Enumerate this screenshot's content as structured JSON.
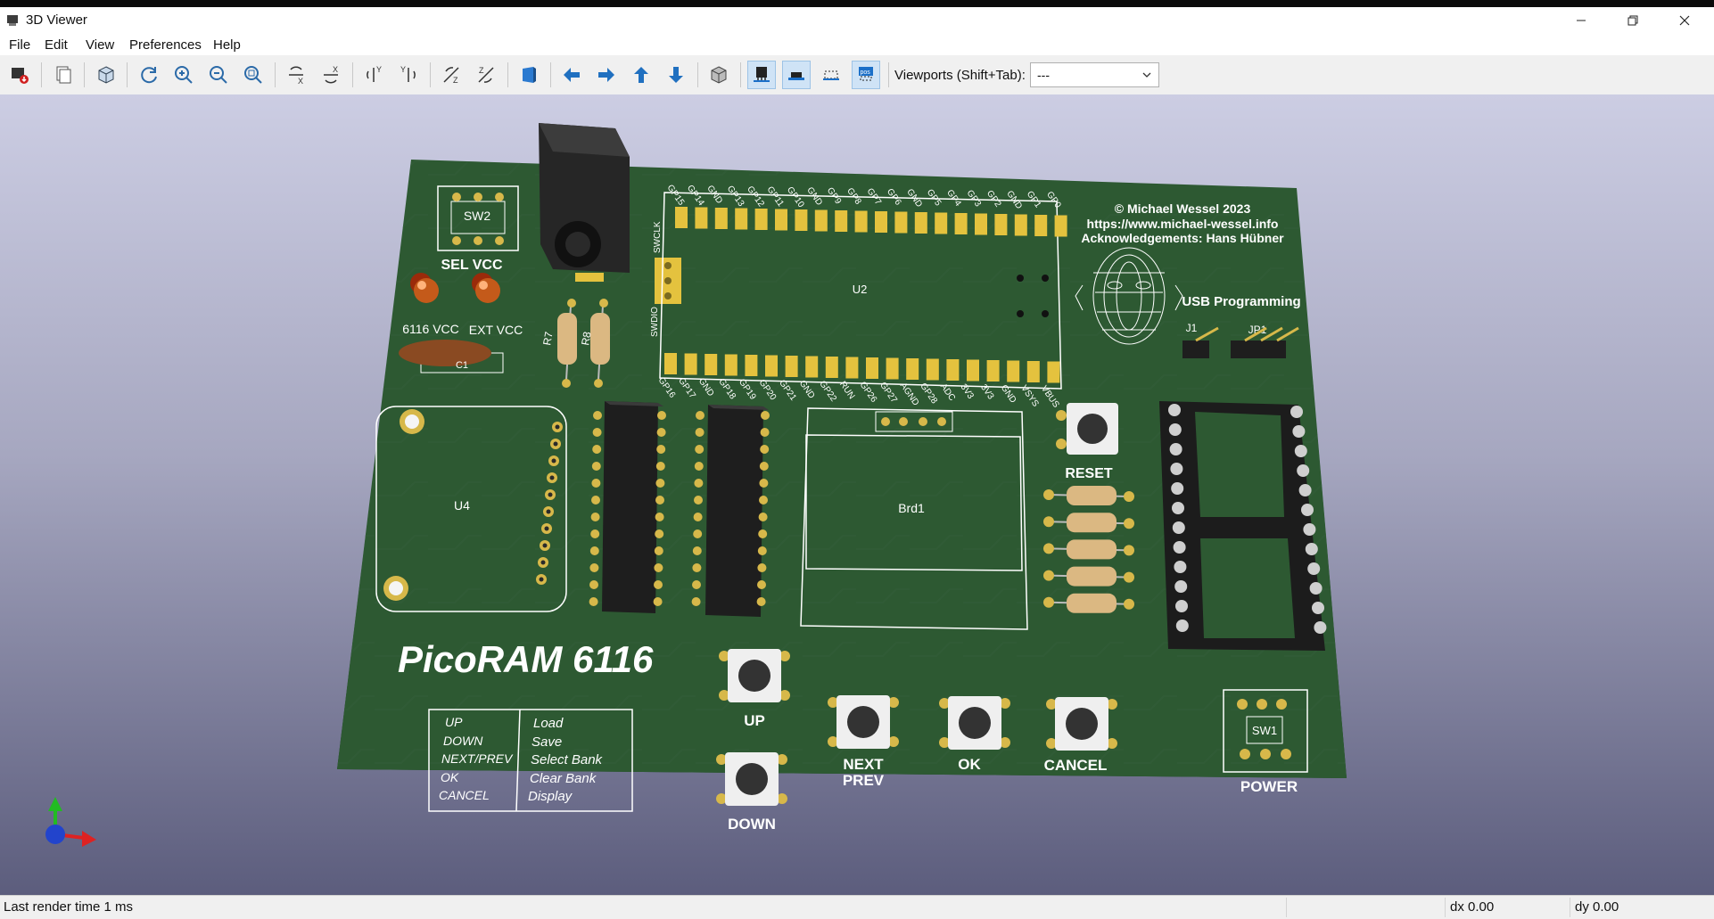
{
  "window": {
    "title": "3D Viewer"
  },
  "menu": [
    "File",
    "Edit",
    "View",
    "Preferences",
    "Help"
  ],
  "toolbar": {
    "viewports_label": "Viewports (Shift+Tab):",
    "viewports_value": "---"
  },
  "board": {
    "title": "PicoRAM 6116",
    "credits": [
      "© Michael Wessel 2023",
      "https://www.michael-wessel.info",
      "Acknowledgements: Hans Hübner"
    ],
    "usb_label": "USB Programming",
    "refs": {
      "sw2": "SW2",
      "sw1": "SW1",
      "u2": "U2",
      "u4": "U4",
      "brd1": "Brd1",
      "r7": "R7",
      "r8": "R8",
      "j1": "J1",
      "jp1": "JP1",
      "c1": "C1",
      "swclk": "SWCLK",
      "swdio": "SWDIO"
    },
    "labels": {
      "sel_vcc": "SEL VCC",
      "vcc_6116": "6116 VCC",
      "ext_vcc": "EXT VCC",
      "reset": "RESET",
      "power": "POWER"
    },
    "buttons": {
      "up": "UP",
      "down": "DOWN",
      "next": "NEXT",
      "prev": "PREV",
      "ok": "OK",
      "cancel": "CANCEL"
    },
    "legend_keys": [
      "UP",
      "DOWN",
      "NEXT/PREV",
      "OK",
      "CANCEL"
    ],
    "legend_actions": [
      "Load",
      "Save",
      "Select Bank",
      "Clear Bank",
      "Display"
    ],
    "gp_top": [
      "GP15",
      "GP14",
      "GND",
      "GP13",
      "GP12",
      "GP11",
      "GP10",
      "GND",
      "GP9",
      "GP8",
      "GP7",
      "GP6",
      "GND",
      "GP5",
      "GP4",
      "GP3",
      "GP2",
      "GND",
      "GP1",
      "GP0"
    ],
    "gp_bottom": [
      "GP16",
      "GP17",
      "GND",
      "GP18",
      "GP19",
      "GP20",
      "GP21",
      "GND",
      "GP22",
      "RUN",
      "GP26",
      "GP27",
      "AGND",
      "GP28",
      "ADC",
      "3V3",
      "3V3",
      "GND",
      "VSYS",
      "VBUS"
    ]
  },
  "status": {
    "render": "Last render time 1 ms",
    "dx": "dx 0.00",
    "dy": "dy 0.00"
  }
}
